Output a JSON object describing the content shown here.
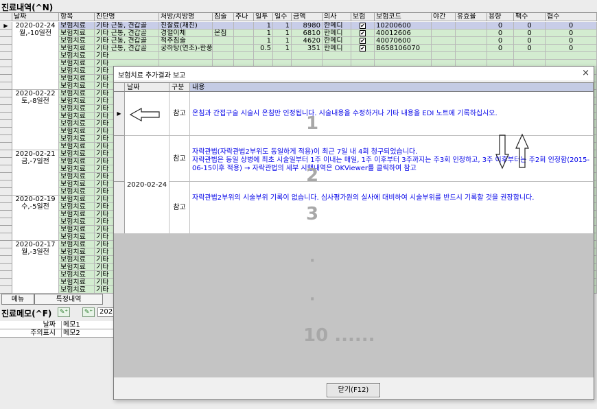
{
  "window_title": "진료내역(^N)",
  "main_grid": {
    "headers": [
      "날짜",
      "항목",
      "진단명",
      "처방/치방명",
      "침술",
      "추나",
      "일투",
      "일수",
      "금액",
      "의사",
      "보험",
      "보험코드",
      "야간",
      "유효율",
      "용량",
      "팩수",
      "협수"
    ],
    "date_blocks": [
      {
        "date": "2020-02-24",
        "sub": "월,-10일전"
      },
      {
        "date": "2020-02-22",
        "sub": "토,-8일전"
      },
      {
        "date": "2020-02-21",
        "sub": "금,-7일전"
      },
      {
        "date": "2020-02-19",
        "sub": "수,-5일전"
      },
      {
        "date": "2020-02-17",
        "sub": "월,-3일전"
      }
    ],
    "rows": [
      {
        "item": "보험치료",
        "diag": "기타 근통, 견갑골",
        "rx": "진찰료(재진)",
        "acu": "",
        "ilt": "1",
        "ils": "1",
        "amt": "8980",
        "doc": "한메디",
        "code": "10200600",
        "v1": "0",
        "v2": "0",
        "v3": "0"
      },
      {
        "item": "보험치료",
        "diag": "기타 근통, 견갑골",
        "rx": "경혈이체",
        "acu": "온침",
        "ilt": "1",
        "ils": "1",
        "amt": "6810",
        "doc": "한메디",
        "code": "40012606",
        "v1": "0",
        "v2": "0",
        "v3": "0"
      },
      {
        "item": "보험치료",
        "diag": "기타 근통, 견갑골",
        "rx": "척추침술",
        "acu": "",
        "ilt": "1",
        "ils": "1",
        "amt": "4620",
        "doc": "한메디",
        "code": "40070600",
        "v1": "0",
        "v2": "0",
        "v3": "0"
      },
      {
        "item": "보험치료",
        "diag": "기타 근통, 견갑골",
        "rx": "궁하탕(연조)-한풍",
        "acu": "",
        "ilt": "0.5",
        "ils": "1",
        "amt": "351",
        "doc": "한메디",
        "code": "B658106070",
        "v1": "0",
        "v2": "0",
        "v3": "0"
      }
    ],
    "other_item": "보험치료",
    "other_diag": "기타"
  },
  "bottom_tabs": [
    "메뉴",
    "특정내역"
  ],
  "memo": {
    "title": "진료메모(^F)",
    "col_date": "날짜",
    "col_memo1": "메모1",
    "row2_label": "주의표시",
    "col_memo2": "메모2",
    "date_field_partial": "202"
  },
  "dialog": {
    "title": "보험치료 추가결과 보고",
    "close_symbol": "×",
    "headers": [
      "날짜",
      "구분",
      "내용"
    ],
    "rows": [
      {
        "date": "",
        "type": "참고",
        "content": "온침과 간접구술 시술시 온침만 인정됩니다. 시술내용을 수정하거나 기타 내용을 EDI 노트에 기록하십시오."
      },
      {
        "date": "2020-02-24",
        "type": "참고",
        "content": "자락관법(자락관법2부위도 동일하게 적용)이 최근 7일 내 4회 청구되었습니다.\n자락관법은 동일 상병에 최초 시술일부터 1주 이내는 매일, 1주 이후부터 3주까지는 주3회 인정하고, 3주 이후부터는 주2회 인정함(2015-06-15이후 적용) → 자락관법의 세부 시행내역은 OKViewer를 클릭하여 참고"
      },
      {
        "date": "",
        "type": "참고",
        "content": "자락관법2부위의 시술부위 기록이 없습니다. 심사평가원의 실사에 대비하여 시술부위를 반드시 기록할 것을 권장합니다."
      }
    ],
    "overlay_numbers": [
      "1",
      "2",
      "3",
      "10 ......"
    ],
    "dots": [
      "·",
      "·"
    ],
    "close_button": "닫기(F12)"
  },
  "colors": {
    "message_text": "#0000e8",
    "row_green": "#d3ecd0",
    "row_selected": "#c8cde8",
    "dialog_gray": "#c4c4c4"
  },
  "checkbox_mark": "✔",
  "row_indicator": "▶"
}
